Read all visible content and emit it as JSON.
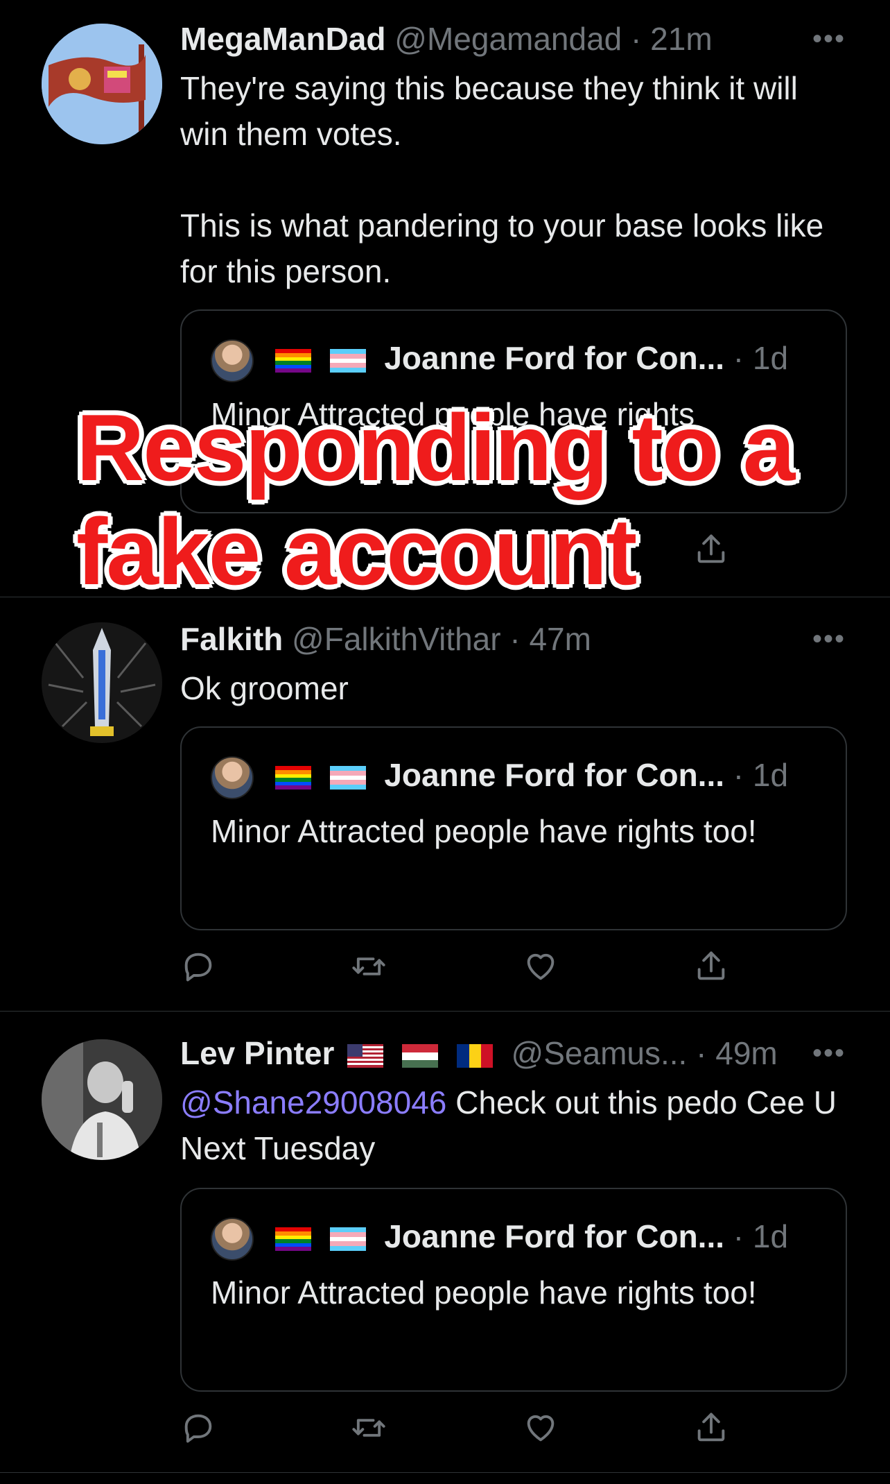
{
  "tweets": [
    {
      "name": "MegaManDad",
      "handle": "@Megamandad",
      "sep": "·",
      "time": "21m",
      "text": "They're saying this because they think it will win them votes.\n\nThis is what pandering to your base looks like for this person.",
      "avatar_icon": "kfc-taco-bell-sign-avatar"
    },
    {
      "name": "Falkith",
      "handle": "@FalkithVithar",
      "sep": "·",
      "time": "47m",
      "text": "Ok groomer",
      "avatar_icon": "sword-avatar"
    },
    {
      "name": "Lev Pinter",
      "handle": "@Seamus...",
      "sep": "·",
      "time": "49m",
      "mention": "@Shane29008046",
      "text": " Check out this pedo Cee U Next Tuesday",
      "avatar_icon": "black-white-photo-avatar"
    }
  ],
  "quote": {
    "name": "Joanne Ford for Con...",
    "sep": "·",
    "time": "1d",
    "text_partial": "Minor Attracted people have rights",
    "text": "Minor Attracted people have rights too!"
  },
  "more_label": "•••",
  "overlay": {
    "line1": "Responding to a",
    "line2": "fake account",
    "color": "#ef1c1c"
  },
  "colors": {
    "background": "#000000",
    "text": "#e7e9ea",
    "muted": "#71767b",
    "mention": "#8b7dff",
    "border": "#2f3336"
  }
}
